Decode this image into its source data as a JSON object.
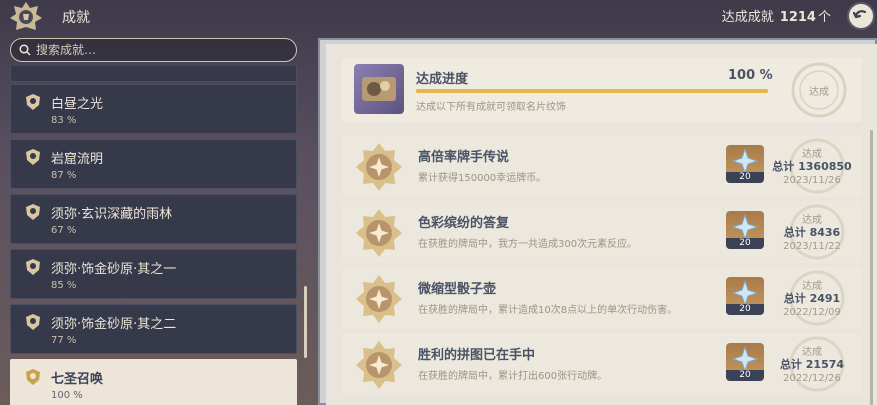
{
  "header": {
    "title": "成就",
    "total_label": "达成成就",
    "total_count": "1214",
    "total_unit": "个"
  },
  "search": {
    "placeholder": "搜索成就…"
  },
  "categories": [
    {
      "name": "白昼之光",
      "pct": "83 %"
    },
    {
      "name": "岩窟流明",
      "pct": "87 %"
    },
    {
      "name": "须弥·玄识深藏的雨林",
      "pct": "67 %"
    },
    {
      "name": "须弥·饰金砂原·其之一",
      "pct": "85 %"
    },
    {
      "name": "须弥·饰金砂原·其之二",
      "pct": "77 %"
    },
    {
      "name": "七圣召唤",
      "pct": "100 %",
      "selected": true
    }
  ],
  "progress": {
    "title": "达成进度",
    "percent": "100 %",
    "fraction": 1.0,
    "desc": "达成以下所有成就可领取名片纹饰",
    "stamp": "达成"
  },
  "achievements": [
    {
      "title": "高倍率牌手传说",
      "desc": "累计获得150000幸运牌币。",
      "reward_qty": "20",
      "status": "达成",
      "total": "总计 1360850",
      "date": "2023/11/26"
    },
    {
      "title": "色彩缤纷的答复",
      "desc": "在获胜的牌局中，我方一共造成300次元素反应。",
      "reward_qty": "20",
      "status": "达成",
      "total": "总计 8436",
      "date": "2023/11/22"
    },
    {
      "title": "微缩型骰子壶",
      "desc": "在获胜的牌局中，累计造成10次8点以上的单次行动伤害。",
      "reward_qty": "20",
      "status": "达成",
      "total": "总计 2491",
      "date": "2022/12/09"
    },
    {
      "title": "胜利的拼图已在手中",
      "desc": "在获胜的牌局中，累计打出600张行动牌。",
      "reward_qty": "20",
      "status": "达成",
      "total": "总计 21574",
      "date": "2022/12/26"
    }
  ],
  "colors": {
    "accent_gold": "#e6b74a",
    "text_dark": "#495366",
    "panel_bg": "#e9e5dc",
    "list_item_bg": "#36394a"
  },
  "icons": {
    "header": "achievement-emblem-icon",
    "back": "back-arrow-icon",
    "search": "search-icon",
    "category": "category-badge-icon",
    "medal": "gold-medal-icon",
    "reward": "primogem-icon"
  }
}
